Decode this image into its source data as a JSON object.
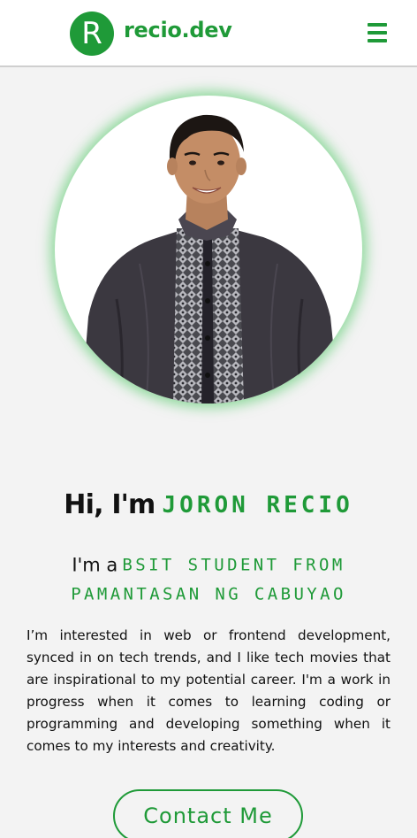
{
  "header": {
    "logo_letter": "R",
    "logo_text": "recio.dev",
    "menu_icon": "hamburger-menu-icon"
  },
  "hero": {
    "photo": "profile-photo",
    "greeting_prefix": "Hi, I'm",
    "name": "JORON RECIO",
    "role_prefix": "I'm a",
    "role_value": "BSIT STUDENT FROM PAMANTASAN NG CABUYAO",
    "bio": "I’m interested in web or frontend development, synced in on tech trends, and I like tech movies that are inspirational to my potential career. I'm a work in progress when it comes to learning coding or programming and developing something when it comes to my interests and creativity.",
    "contact_label": "Contact Me"
  },
  "colors": {
    "accent": "#1f9a38",
    "background": "#f3f3f3",
    "header_bg": "#ffffff",
    "glow": "#40c458"
  }
}
